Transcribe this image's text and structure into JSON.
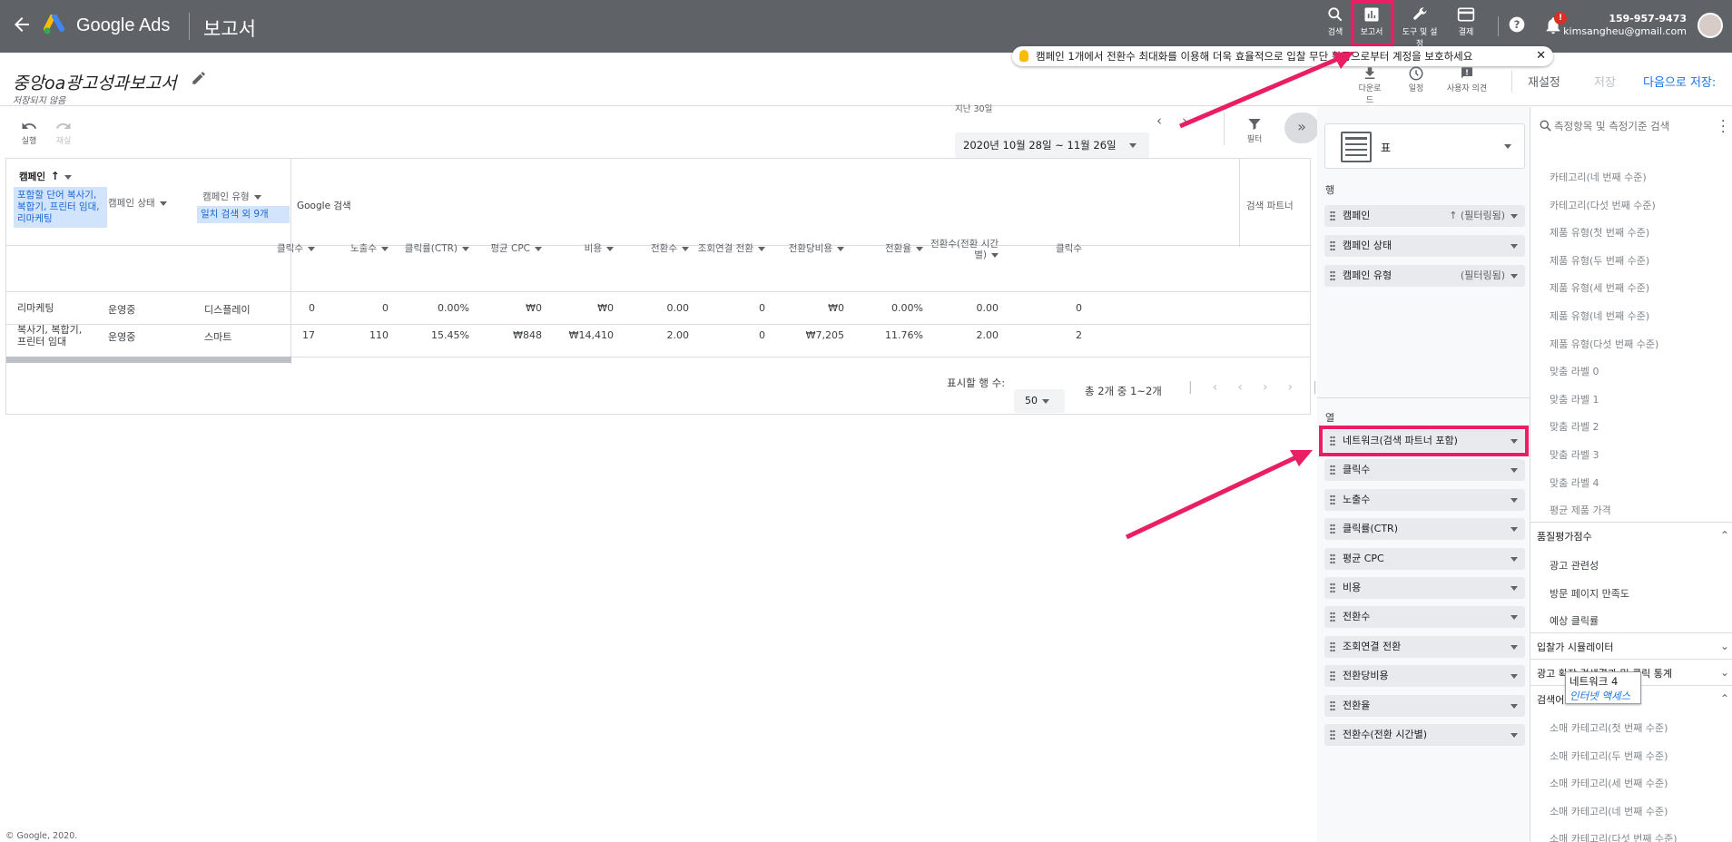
{
  "topbar": {
    "brand": "Google Ads",
    "section": "보고서",
    "buttons": {
      "search": "검색",
      "reports": "보고서",
      "tools": "도구 및 설정",
      "billing": "결제"
    },
    "account_id": "159-957-9473",
    "account_email": "kimsangheu@gmail.com",
    "notification_badge": "!"
  },
  "tip": {
    "text": "캠페인 1개에서 전환수 최대화를 이용해 더욱 효율적으로 입찰  무단 활동으로부터 계정을 보호하세요",
    "close": "✕"
  },
  "report": {
    "title": "중앙oa광고성과보고서",
    "status": "저장되지 않음",
    "undo": "실행",
    "redo": "재실",
    "download": "다운로드",
    "schedule": "일정",
    "feedback": "사용자 의견",
    "reset": "재설정",
    "save": "저장",
    "save_as": "다음으로 저장:",
    "date_label": "지난 30일",
    "date_range": "2020년 10월 28일 ~ 11월 26일",
    "filter": "필터"
  },
  "table": {
    "row_headers": {
      "campaign": "캠페인",
      "campaign_status": "캠페인 상태",
      "campaign_type": "캠페인 유형"
    },
    "campaign_filter": "포함할 단어 복사기, 복합기, 프린터 임대, 리마케팅",
    "type_filter": "일치 검색 외 9개",
    "network_group": "Google 검색",
    "network_group2": "검색 파트너",
    "columns": [
      "클릭수",
      "노출수",
      "클릭률(CTR)",
      "평균 CPC",
      "비용",
      "전환수",
      "조회연결 전환",
      "전환당비용",
      "전환율",
      "전환수(전환 시간별)",
      "클릭수"
    ],
    "rows": [
      {
        "campaign": "리마케팅",
        "status": "운영중",
        "type": "디스플레이",
        "values": [
          "0",
          "0",
          "0.00%",
          "₩0",
          "₩0",
          "0.00",
          "0",
          "₩0",
          "0.00%",
          "0.00",
          "0"
        ]
      },
      {
        "campaign": "복사기, 복합기, 프린터 임대",
        "status": "운영중",
        "type": "스마트",
        "values": [
          "17",
          "110",
          "15.45%",
          "₩848",
          "₩14,410",
          "2.00",
          "0",
          "₩7,205",
          "11.76%",
          "2.00",
          "2"
        ]
      }
    ],
    "rows_per_page_label": "표시할 행 수:",
    "rows_per_page": "50",
    "pagination_text": "총 2개 중 1~2개"
  },
  "config": {
    "viz_type": "표",
    "rows_label": "행",
    "rows": [
      {
        "label": "캠페인",
        "extra": "↑ (필터링됨)"
      },
      {
        "label": "캠페인 상태",
        "extra": ""
      },
      {
        "label": "캠페인 유형",
        "extra": "(필터링됨)"
      }
    ],
    "cols_label": "열",
    "cols": [
      "네트워크(검색 파트너 포함)",
      "클릭수",
      "노출수",
      "클릭률(CTR)",
      "평균 CPC",
      "비용",
      "전환수",
      "조회연결 전환",
      "전환당비용",
      "전환율",
      "전환수(전환 시간별)"
    ]
  },
  "metrics_panel": {
    "search_placeholder": "측정항목 및 측정기준 검색",
    "items_top": [
      "카테고리(네 번째 수준)",
      "카테고리(다섯 번째 수준)",
      "제품 유형(첫 번째 수준)",
      "제품 유형(두 번째 수준)",
      "제품 유형(세 번째 수준)",
      "제품 유형(네 번째 수준)",
      "제품 유형(다섯 번째 수준)",
      "맞춤 라벨 0",
      "맞춤 라벨 1",
      "맞춤 라벨 2",
      "맞춤 라벨 3",
      "맞춤 라벨 4",
      "평균 제품 가격"
    ],
    "quality_section": "품질평가점수",
    "quality_items": [
      "광고 관련성",
      "방문 페이지 만족도",
      "예상 클릭률"
    ],
    "bid_section": "입찰가 시뮬레이터",
    "ad_section": "광고 확장 검색결과 및 클릭 통계",
    "search_section": "검색어",
    "bottom_items": [
      "소매 카테고리(첫 번째 수준)",
      "소매 카테고리(두 번째 수준)",
      "소매 카테고리(세 번째 수준)",
      "소매 카테고리(네 번째 수준)",
      "소매 카테고리(다섯 번째 수준)"
    ],
    "tooltip_title": "네트워크 4",
    "tooltip_sub": "인터넷 액세스"
  },
  "footer": "© Google, 2020.",
  "colors": {
    "topbar": "#5f6368",
    "highlight": "#e91e63",
    "accent": "#1a73e8",
    "filter_chip": "#d2e3fc"
  }
}
